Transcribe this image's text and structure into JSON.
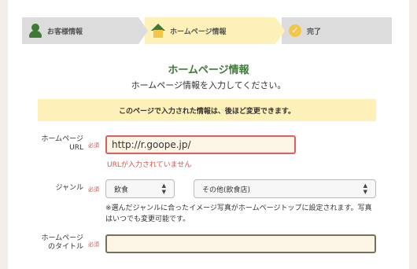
{
  "steps": [
    {
      "label": "お客様情報",
      "icon": "person-icon",
      "state": "done"
    },
    {
      "label": "ホームページ情報",
      "icon": "house-icon",
      "state": "current"
    },
    {
      "label": "完了",
      "icon": "check-icon",
      "state": "pending"
    }
  ],
  "page": {
    "title": "ホームページ情報",
    "subtitle": "ホームページ情報を入力してください。",
    "notice": "このページで入力された情報は、後ほど変更できます。"
  },
  "form": {
    "required_label": "必須",
    "url": {
      "label_line1": "ホームページ",
      "label_line2": "URL",
      "value": "http://r.goope.jp/",
      "error": "URLが入力されていません"
    },
    "genre": {
      "label": "ジャンル",
      "selected": "飲食",
      "sub_selected": "その他(飲食店)",
      "note": "※選んだジャンルに合ったイメージ写真がホームページトップに設定されます。写真はいつでも変更可能です。"
    },
    "site_title": {
      "label_line1": "ホームページ",
      "label_line2": "のタイトル",
      "value": ""
    }
  },
  "colors": {
    "accent_green": "#3c7a35",
    "notice_bg": "#fdf0b8",
    "error_red": "#d9534f"
  }
}
